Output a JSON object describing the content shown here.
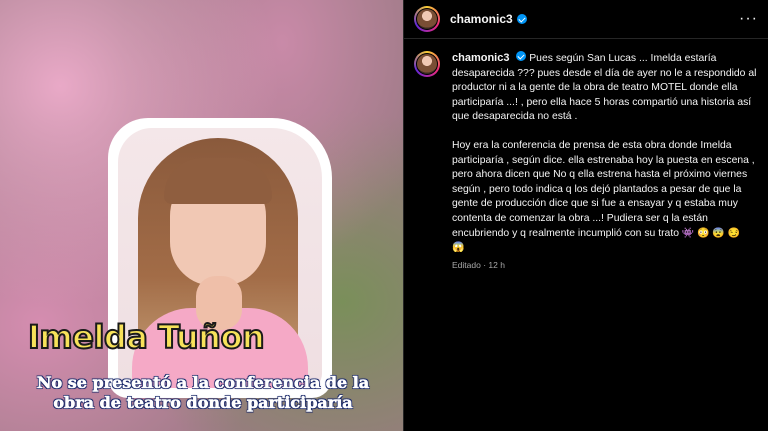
{
  "media": {
    "headline_name": "Imelda Tuñon",
    "caption": "No se presentó a la conferencia de la obra de teatro donde participaría"
  },
  "post": {
    "username": "chamonic3",
    "more_label": "···",
    "paragraph1": "Pues según San Lucas ... Imelda estaría desaparecida ??? pues desde el día de ayer no le a respondido al productor ni a la gente de la obra de teatro MOTEL donde ella participaría ...! , pero ella hace 5 horas compartió una historia así que desaparecida no está .",
    "paragraph2": "Hoy era la conferencia de prensa de esta obra donde Imelda participaría , según dice. ella estrenaba hoy la puesta en escena , pero ahora dicen que No q ella estrena hasta el próximo viernes según , pero todo indica q los dejó plantados a pesar de que la gente de producción dice que si fue a ensayar y q estaba muy contenta de comenzar la obra ...! Pudiera ser q la están encubriendo y q realmente incumplió con su trato",
    "emojis": "👾 😳 😨 😏",
    "emoji_last": "😱",
    "edited": "Editado",
    "time": "12 h"
  }
}
